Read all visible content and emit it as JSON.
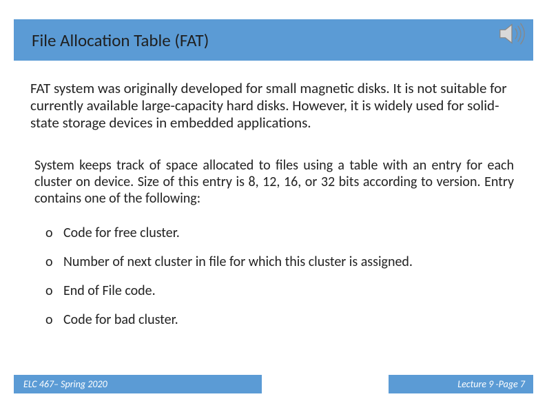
{
  "title": "File Allocation Table (FAT)",
  "paragraph1": "FAT system was originally developed for small magnetic disks.  It is not suitable for currently available large-capacity hard disks.  However, it is widely used for solid-state storage devices in embedded applications.",
  "paragraph2": "System keeps track of space allocated to files using a table with an entry for each cluster on device.  Size of this entry is 8, 12, 16, or 32 bits according to version.  Entry contains one of the following:",
  "bullets": [
    "Code for free cluster.",
    "Number of next cluster in file for which this cluster is assigned.",
    "End of File code.",
    "Code for bad cluster."
  ],
  "footer_left": "ELC 467– Spring 2020",
  "footer_right": "Lecture 9 -Page 7"
}
